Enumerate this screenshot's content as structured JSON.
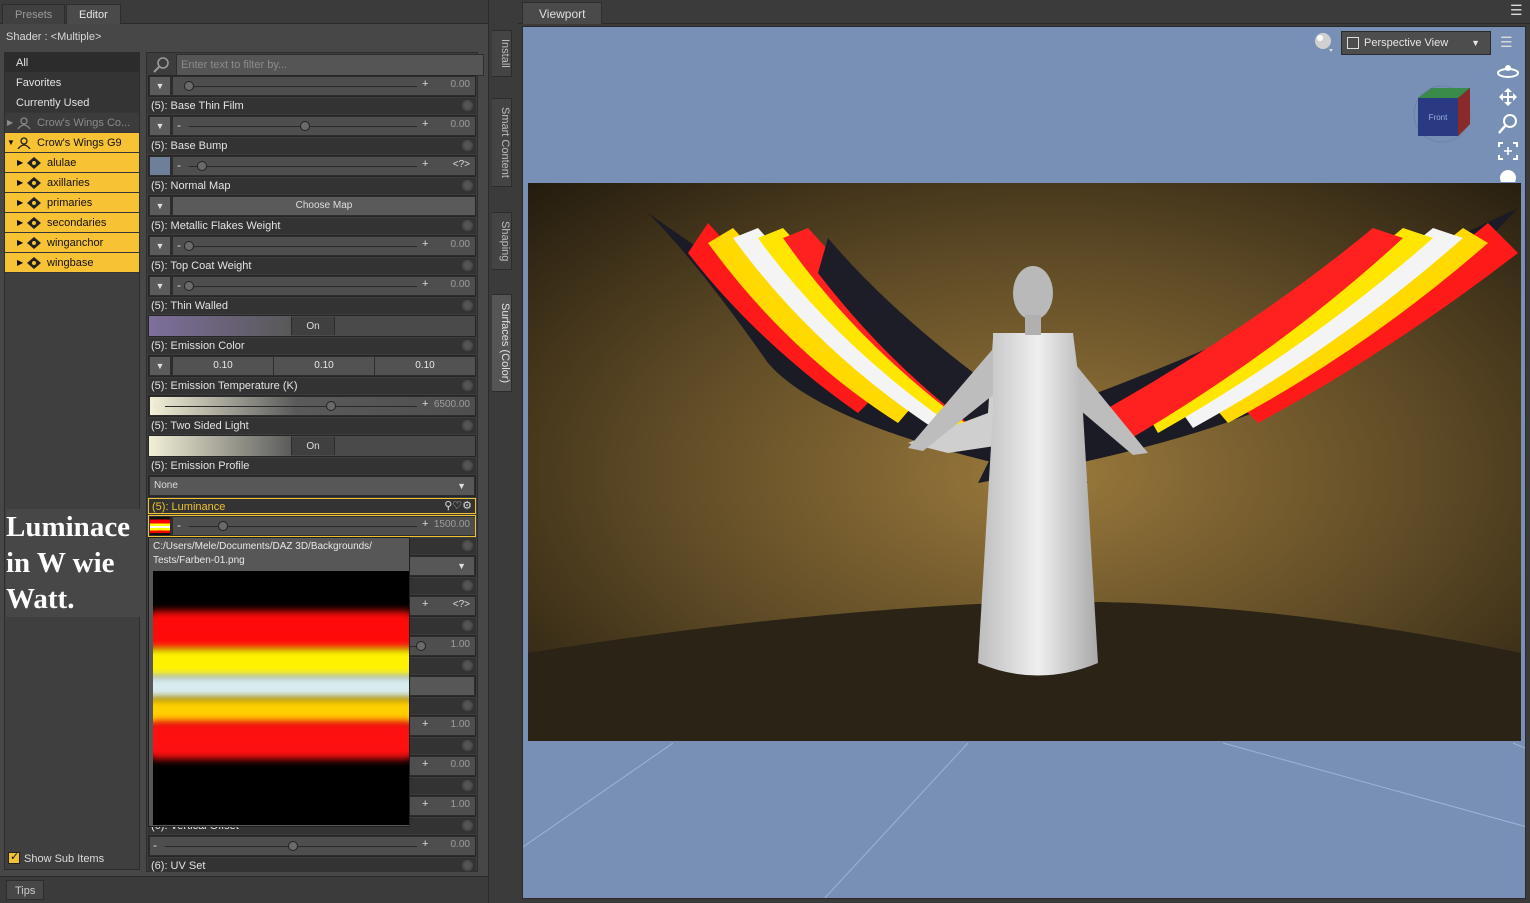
{
  "pane_tabs": [
    "Presets",
    "Editor"
  ],
  "shader": {
    "label": "Shader :",
    "value": "<Multiple>"
  },
  "tree": {
    "items": [
      {
        "label": "All",
        "style": "dark"
      },
      {
        "label": "Favorites",
        "style": "mid"
      },
      {
        "label": "Currently Used",
        "style": "mid"
      },
      {
        "label": "Crow's Wings Co...",
        "style": "gray"
      },
      {
        "label": "Crow's Wings G9",
        "style": "sel-root"
      },
      {
        "label": "alulae",
        "style": "sel"
      },
      {
        "label": "axillaries",
        "style": "sel"
      },
      {
        "label": "primaries",
        "style": "sel"
      },
      {
        "label": "secondaries",
        "style": "sel"
      },
      {
        "label": "winganchor",
        "style": "sel"
      },
      {
        "label": "wingbase",
        "style": "sel"
      }
    ],
    "show_sub_items": "Show Sub Items"
  },
  "overlay_note": [
    "Luminace",
    "in W wie",
    "Watt."
  ],
  "filter_placeholder": "Enter text to filter by...",
  "properties": {
    "top_value": "0.00",
    "base_thin_film": {
      "label": "(5): Base Thin Film",
      "value": "0.00"
    },
    "base_bump": {
      "label": "(5): Base Bump",
      "value": "<?>"
    },
    "normal_map": {
      "label": "(5): Normal Map",
      "button": "Choose Map"
    },
    "metallic_flakes": {
      "label": "(5): Metallic Flakes Weight",
      "value": "0.00"
    },
    "top_coat": {
      "label": "(5): Top Coat Weight",
      "value": "0.00"
    },
    "thin_walled": {
      "label": "(5): Thin Walled",
      "value": "On"
    },
    "emission_color": {
      "label": "(5): Emission Color",
      "r": "0.10",
      "g": "0.10",
      "b": "0.10"
    },
    "emission_temp": {
      "label": "(5): Emission Temperature (K)",
      "value": "6500.00"
    },
    "two_sided": {
      "label": "(5): Two Sided Light",
      "value": "On"
    },
    "emission_profile": {
      "label": "(5): Emission Profile",
      "value": "None"
    },
    "luminance": {
      "label": "(5): Luminance",
      "value": "1500.00"
    },
    "lower_values": [
      "<?>",
      "1.00",
      "1.00",
      "0.00",
      "1.00",
      "0.00"
    ],
    "vertical_offset": {
      "label": "(6): Vertical Offset",
      "value": "0.00"
    },
    "uv_set": {
      "label": "(6): UV Set"
    }
  },
  "popup": {
    "path": "C:/Users/Mele/Documents/DAZ 3D/Backgrounds/ Tests/Farben-01.png"
  },
  "side_tabs": [
    "Install",
    "Smart Content",
    "Shaping",
    "Surfaces (Color)"
  ],
  "tips": "Tips",
  "viewport": {
    "tab": "Viewport",
    "camera": "Perspective View",
    "cube_face": "Front"
  },
  "colors": {
    "selection": "#f7c234",
    "viewport_bg": "#7890b6",
    "panel_bg": "#474747"
  }
}
